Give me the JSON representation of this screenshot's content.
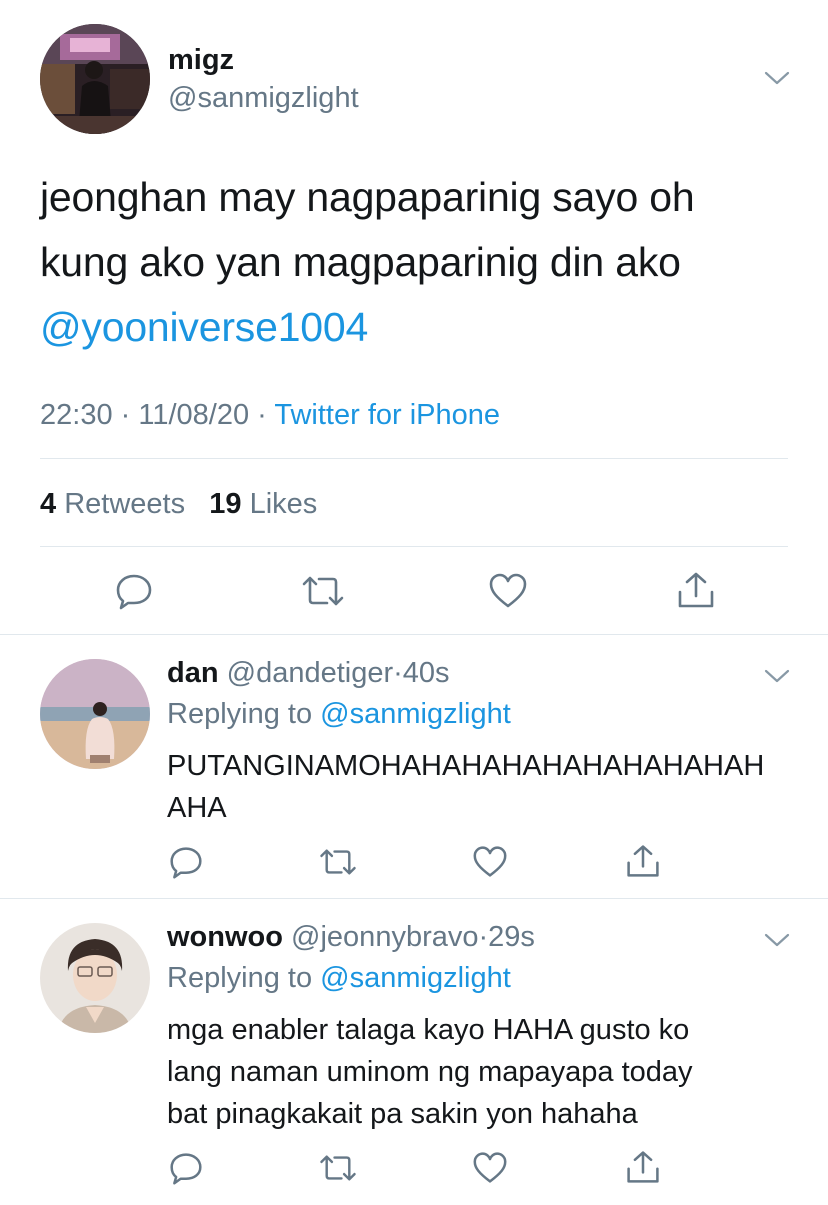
{
  "main_tweet": {
    "display_name": "migz",
    "handle": "@sanmigzlight",
    "text_lines": [
      "jeonghan may nagpaparinig sayo oh",
      "kung ako yan magpaparinig din ako"
    ],
    "mention": "@yooniverse1004",
    "time": "22:30",
    "date": "11/08/20",
    "source": "Twitter for iPhone",
    "retweet_count": "4",
    "retweets_label": "Retweets",
    "like_count": "19",
    "likes_label": "Likes",
    "actions": [
      "reply-icon",
      "retweet-icon",
      "like-icon",
      "share-icon"
    ]
  },
  "replies": [
    {
      "display_name": "dan",
      "handle": "@dandetiger",
      "time": "40s",
      "replying_label": "Replying to",
      "replying_to": "@sanmigzlight",
      "text_lines": [
        "PUTANGINAMOHAHAHAHAHAHAHAHAHAH",
        "AHA"
      ]
    },
    {
      "display_name": "wonwoo",
      "handle": "@jeonnybravo",
      "time": "29s",
      "replying_label": "Replying to",
      "replying_to": "@sanmigzlight",
      "text_lines": [
        "mga enabler talaga kayo HAHA gusto ko",
        "lang naman uminom ng mapayapa today",
        "bat pinagkakait pa sakin yon hahaha"
      ]
    }
  ],
  "colors": {
    "link": "#1b95e0",
    "secondary": "#657786",
    "text": "#14171a",
    "divider": "#e1e8ed"
  }
}
